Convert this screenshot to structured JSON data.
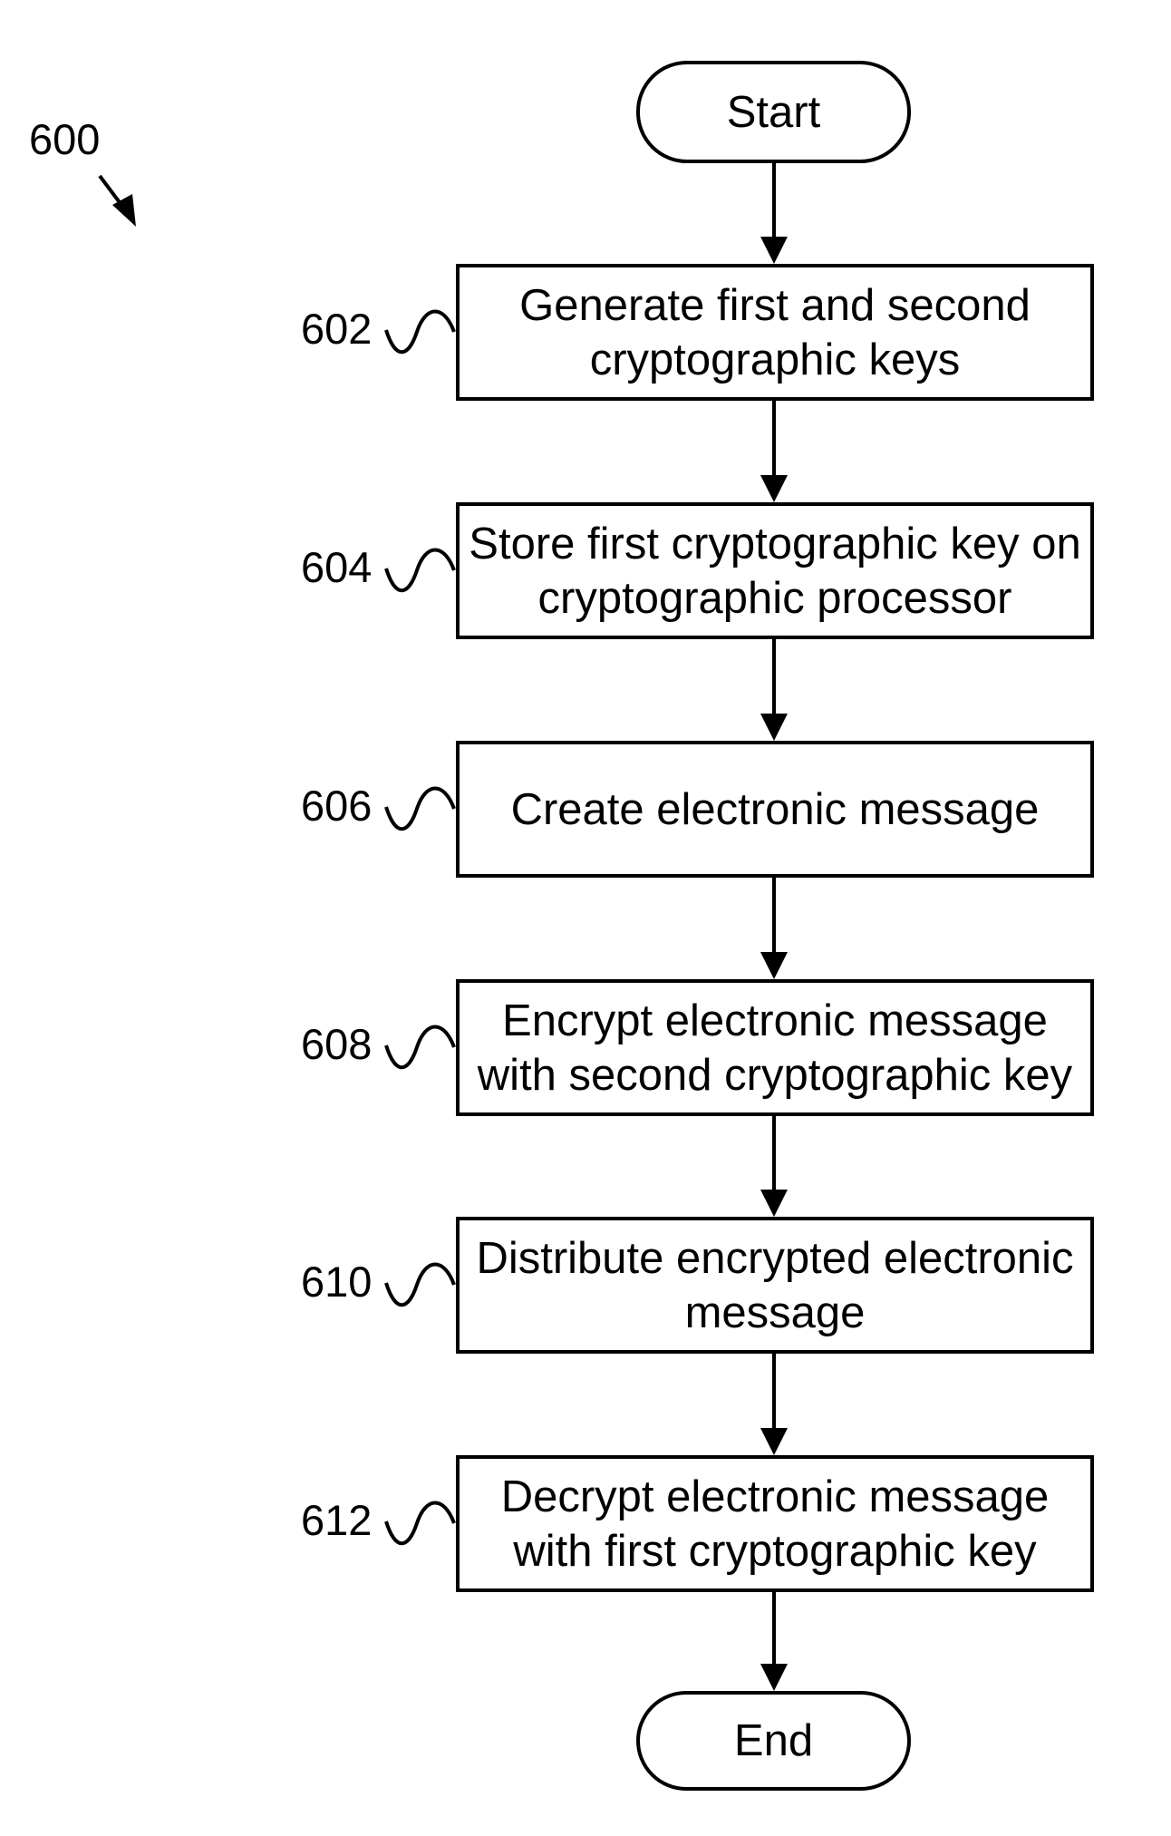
{
  "figure_label": "600",
  "start": {
    "label": "Start"
  },
  "end": {
    "label": "End"
  },
  "steps": [
    {
      "ref": "602",
      "text": "Generate first and second cryptographic keys"
    },
    {
      "ref": "604",
      "text": "Store first cryptographic key on cryptographic processor"
    },
    {
      "ref": "606",
      "text": "Create electronic message"
    },
    {
      "ref": "608",
      "text": "Encrypt electronic message with second cryptographic key"
    },
    {
      "ref": "610",
      "text": "Distribute encrypted electronic message"
    },
    {
      "ref": "612",
      "text": "Decrypt electronic message with first cryptographic key"
    }
  ]
}
